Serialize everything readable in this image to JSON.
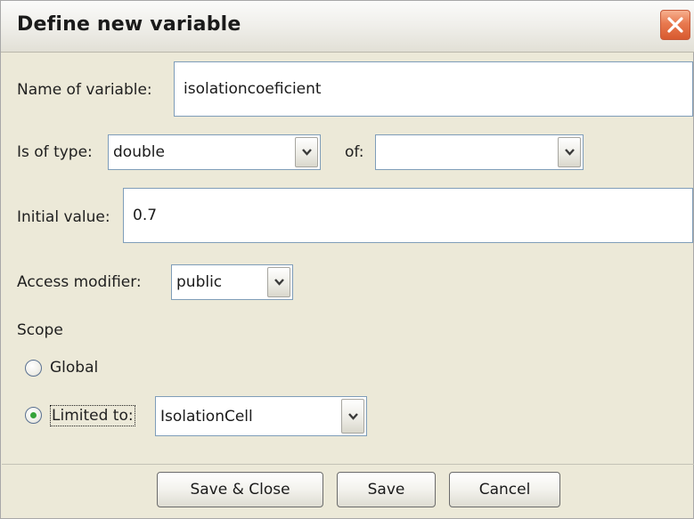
{
  "dialog": {
    "title": "Define new variable"
  },
  "name_field": {
    "label": "Name of variable:",
    "value": "isolationcoeficient"
  },
  "type_row": {
    "label": "Is of type:",
    "type_value": "double",
    "of_label": "of:",
    "of_value": ""
  },
  "initial_value": {
    "label": "Initial value:",
    "value": "0.7"
  },
  "access": {
    "label": "Access modifier:",
    "value": "public"
  },
  "scope": {
    "label": "Scope",
    "global_label": "Global",
    "global_selected": false,
    "limited_label": "Limited to:",
    "limited_selected": true,
    "limited_value": "IsolationCell"
  },
  "buttons": {
    "save_close": "Save & Close",
    "save": "Save",
    "cancel": "Cancel"
  },
  "icons": {
    "close": "close-icon",
    "dropdown": "chevron-down-icon"
  },
  "colors": {
    "close_button": "#e8794f",
    "radio_dot": "#36a43a",
    "field_border": "#7f9db9"
  }
}
